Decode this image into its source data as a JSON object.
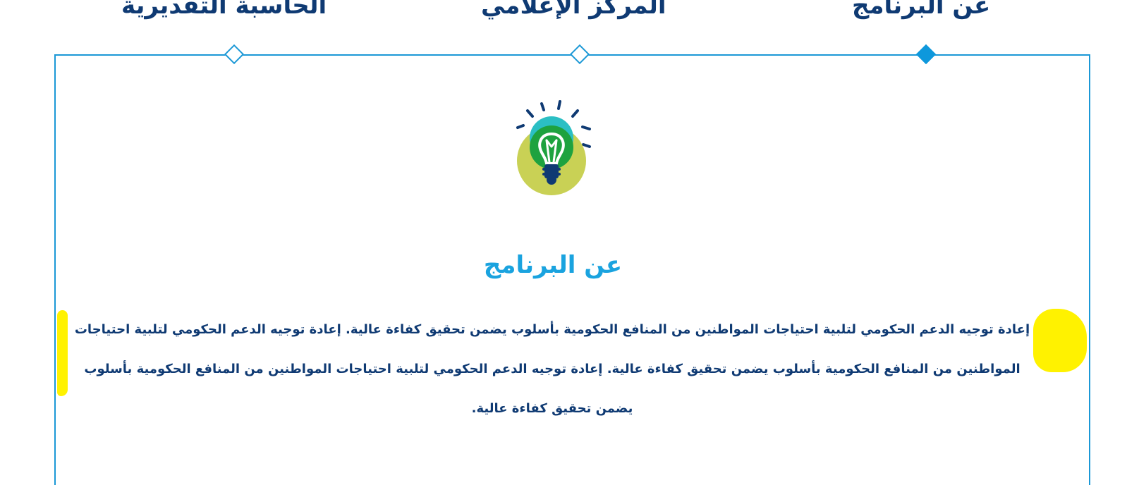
{
  "tabs": [
    {
      "label": "عن البرنامج",
      "active": true
    },
    {
      "label": "المركز الإعلامي",
      "active": false
    },
    {
      "label": "الحاسبة التقديرية",
      "active": false
    }
  ],
  "section": {
    "icon": "lightbulb-icon",
    "title": "عن البرنامج",
    "body": "إعادة توجيه الدعم الحكومي لتلبية احتياجات المواطنين من المنافع الحكومية بأسلوب يضمن تحقيق كفاءة عالية. إعادة توجيه الدعم الحكومي لتلبية احتياجات المواطنين من المنافع الحكومية بأسلوب يضمن تحقيق كفاءة عالية. إعادة توجيه الدعم الحكومي لتلبية احتياجات المواطنين من المنافع الحكومية بأسلوب يضمن تحقيق كفاءة عالية."
  },
  "colors": {
    "primary_text": "#0f3a73",
    "accent": "#1aa3df",
    "border": "#1b98d6",
    "highlight": "#fff200",
    "bulb_circle": "#c9d155",
    "bulb_green": "#1ea23f",
    "bulb_teal": "#2bbfc4"
  }
}
